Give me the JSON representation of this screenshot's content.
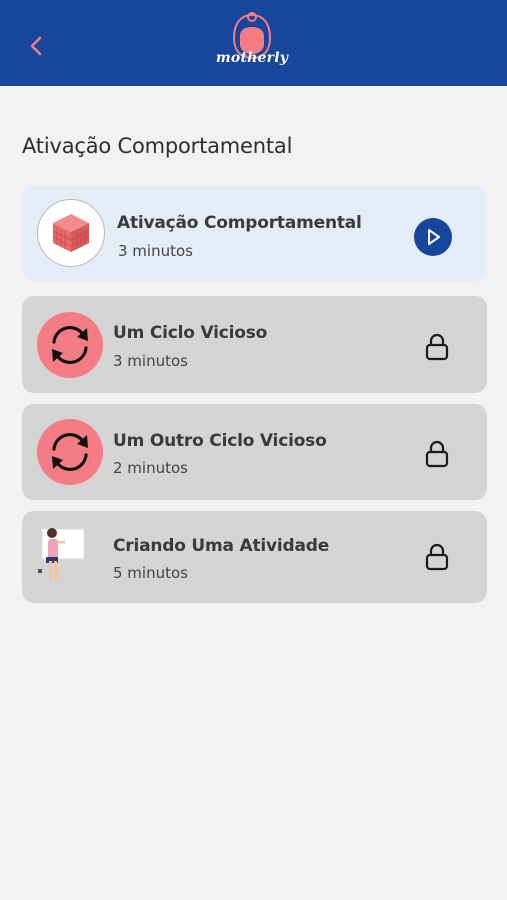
{
  "header": {
    "brand": "motherly",
    "colors": {
      "bar": "#17469d",
      "accent": "#f47c85"
    }
  },
  "page": {
    "title": "Ativação Comportamental"
  },
  "modules": [
    {
      "title": "Ativação Comportamental",
      "duration": "3 minutos",
      "icon": "cube-icon",
      "status": "unlocked",
      "action_icon": "play-icon"
    },
    {
      "title": "Um Ciclo Vicioso",
      "duration": "3 minutos",
      "icon": "cycle-icon",
      "status": "locked",
      "action_icon": "lock-icon"
    },
    {
      "title": "Um Outro Ciclo Vicioso",
      "duration": "2 minutos",
      "icon": "cycle-icon",
      "status": "locked",
      "action_icon": "lock-icon"
    },
    {
      "title": "Criando Uma Atividade",
      "duration": "5 minutos",
      "icon": "woman-whiteboard-illustration",
      "status": "locked",
      "action_icon": "lock-icon"
    }
  ]
}
